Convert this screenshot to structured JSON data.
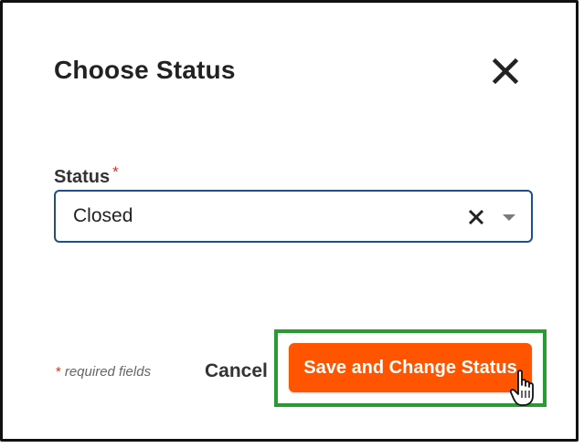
{
  "dialog": {
    "title": "Choose Status",
    "close_icon": "close-icon"
  },
  "status_field": {
    "label": "Status",
    "required_marker": "*",
    "value": "Closed",
    "clear_icon": "clear-x-icon",
    "dropdown_icon": "caret-down-icon"
  },
  "footer": {
    "required_marker": "*",
    "required_note": "required fields",
    "cancel_label": "Cancel",
    "save_label": "Save and Change Status"
  },
  "colors": {
    "accent": "#ff5500",
    "highlight": "#2a9a33",
    "input_border": "#1f4e8c",
    "required": "#d93025"
  }
}
